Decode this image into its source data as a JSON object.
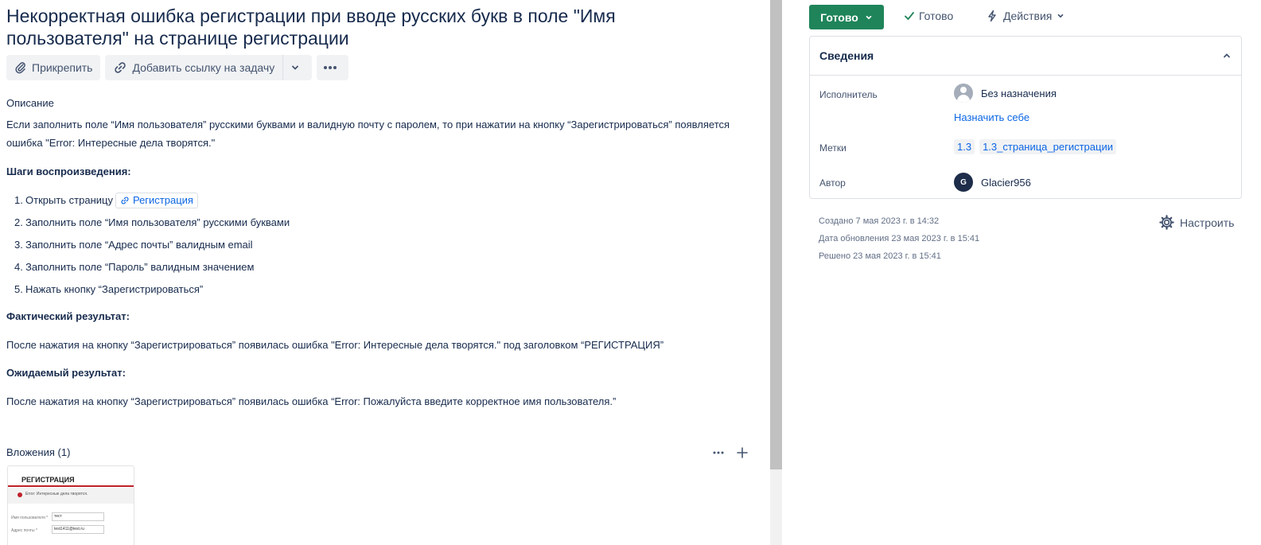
{
  "issue": {
    "title": "Некорректная ошибка регистрации при вводе русских букв в поле \"Имя пользователя\" на странице регистрации"
  },
  "toolbar": {
    "attach_label": "Прикрепить",
    "add_link_label": "Добавить ссылку на задачу"
  },
  "description": {
    "heading": "Описание",
    "text": "Если заполнить поле “Имя пользователя” русскими буквами и валидную почту с паролем, то при нажатии на кнопку “Зарегистрироваться” появляется ошибка \"Error: Интересные дела творятся.\"",
    "steps_heading": "Шаги воспроизведения:",
    "steps": [
      {
        "num": "1.",
        "text": "Открыть страницу",
        "link": "Регистрация"
      },
      {
        "num": "2.",
        "text": "Заполнить поле “Имя пользователя” русскими буквами"
      },
      {
        "num": "3.",
        "text": "Заполнить поле “Адрес почты” валидным email"
      },
      {
        "num": "4.",
        "text": "Заполнить поле “Пароль” валидным значением"
      },
      {
        "num": "5.",
        "text": "Нажать кнопку “Зарегистрироваться”"
      }
    ],
    "actual_heading": "Фактический результат:",
    "actual_text": "После нажатия на кнопку “Зарегистрироваться” появилась ошибка \"Error: Интересные дела творятся.\" под заголовком “РЕГИСТРАЦИЯ”",
    "expected_heading": "Ожидаемый результат:",
    "expected_text": "После нажатия на кнопку “Зарегистрироваться” появилась ошибка “Error: Пожалуйста введите корректное имя пользователя.”"
  },
  "attachments": {
    "heading": "Вложения (1)",
    "thumb": {
      "title": "РЕГИСТРАЦИЯ",
      "error": "Error: Интересные дела творятся.",
      "username_label": "Имя пользователя *",
      "username_value": "тест",
      "email_label": "Адрес почты *",
      "email_value": "test1411@test.ru"
    }
  },
  "sidebar": {
    "status_button": "Готово",
    "resolution": "Готово",
    "actions": "Действия",
    "details_heading": "Сведения",
    "assignee_label": "Исполнитель",
    "assignee_value": "Без назначения",
    "assign_to_me": "Назначить себе",
    "labels_label": "Метки",
    "labels": [
      "1.3",
      "1.3_страница_регистрации"
    ],
    "reporter_label": "Автор",
    "reporter_initial": "G",
    "reporter_name": "Glacier956",
    "created": "Создано 7 мая 2023 г. в 14:32",
    "updated": "Дата обновления 23 мая 2023 г. в 15:41",
    "resolved": "Решено 23 мая 2023 г. в 15:41",
    "configure": "Настроить"
  },
  "colors": {
    "status_green": "#1f845a",
    "link_blue": "#0c66e4",
    "text_dark": "#172b4d"
  }
}
